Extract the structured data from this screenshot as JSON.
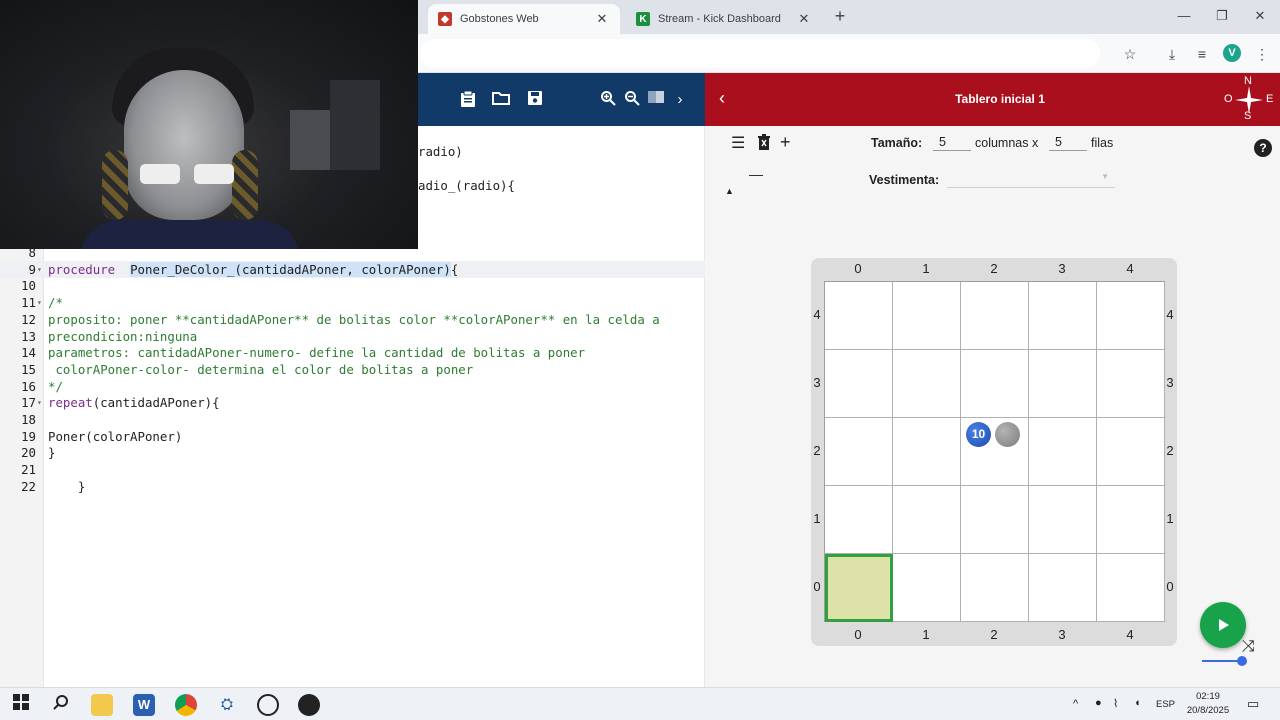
{
  "browser": {
    "tabs": [
      {
        "label": "Gobstones Web",
        "favicon": "gobstones-icon",
        "color": "#c0392b",
        "active": true
      },
      {
        "label": "Stream - Kick Dashboard",
        "favicon": "kick-icon",
        "color": "#1e8e3e",
        "active": false
      }
    ],
    "new_tab": "+",
    "window_controls": {
      "minimize": "—",
      "maximize": "❐",
      "close": "✕"
    },
    "avatar_letter": "V"
  },
  "editor": {
    "lines": [
      {
        "n": "8",
        "fold": "",
        "segments": []
      },
      {
        "n": "9",
        "fold": "▾",
        "current": true,
        "segments": [
          {
            "t": "procedure",
            "c": "kw"
          },
          {
            "t": "  ",
            "c": ""
          },
          {
            "t": "Poner_DeColor_(cantidadAPoner, colorAPoner)",
            "c": "sel"
          },
          {
            "t": "{",
            "c": ""
          }
        ]
      },
      {
        "n": "10",
        "fold": "",
        "segments": []
      },
      {
        "n": "11",
        "fold": "▾",
        "segments": [
          {
            "t": "/*",
            "c": "cm"
          }
        ]
      },
      {
        "n": "12",
        "fold": "",
        "segments": [
          {
            "t": "proposito: poner **cantidadAPoner** de bolitas color **colorAPoner** en la celda a",
            "c": "cm"
          }
        ]
      },
      {
        "n": "13",
        "fold": "",
        "segments": [
          {
            "t": "precondicion:ninguna",
            "c": "cm"
          }
        ]
      },
      {
        "n": "14",
        "fold": "",
        "segments": [
          {
            "t": "parametros: cantidadAPoner-numero- define la cantidad de bolitas a poner",
            "c": "cm"
          }
        ]
      },
      {
        "n": "15",
        "fold": "",
        "segments": [
          {
            "t": " colorAPoner-color- determina el color de bolitas a poner",
            "c": "cm"
          }
        ]
      },
      {
        "n": "16",
        "fold": "",
        "segments": [
          {
            "t": "*/",
            "c": "cm"
          }
        ]
      },
      {
        "n": "17",
        "fold": "▾",
        "segments": [
          {
            "t": "repeat",
            "c": "kw"
          },
          {
            "t": "(cantidadAPoner){",
            "c": ""
          }
        ]
      },
      {
        "n": "18",
        "fold": "",
        "segments": []
      },
      {
        "n": "19",
        "fold": "",
        "segments": [
          {
            "t": "Poner(colorAPoner)",
            "c": ""
          }
        ]
      },
      {
        "n": "20",
        "fold": "",
        "segments": [
          {
            "t": "}",
            "c": ""
          }
        ]
      },
      {
        "n": "21",
        "fold": "",
        "segments": []
      },
      {
        "n": "22",
        "fold": "",
        "segments": [
          {
            "t": "    }",
            "c": ""
          }
        ]
      }
    ],
    "hidden_fragment_1": "radio)",
    "hidden_fragment_2": "adio_(radio){"
  },
  "board": {
    "title": "Tablero inicial 1",
    "compass": {
      "n": "N",
      "s": "S",
      "e": "E",
      "o": "O"
    },
    "size_label": "Tamaño:",
    "columns_value": "5",
    "columns_label": "columnas x",
    "rows_value": "5",
    "rows_label": "filas",
    "attire_label": "Vestimenta:",
    "help": "?",
    "columns": [
      "0",
      "1",
      "2",
      "3",
      "4"
    ],
    "rows_top_to_bottom": [
      "4",
      "3",
      "2",
      "1",
      "0"
    ],
    "head_cell": {
      "x": 0,
      "y": 0
    },
    "stones": [
      {
        "x": 2,
        "y": 2,
        "color": "blue",
        "count": "10"
      },
      {
        "x": 2,
        "y": 2,
        "color": "gray",
        "count": ""
      }
    ],
    "colors": {
      "header": "#a90f1d",
      "head_border": "#30a040",
      "head_fill": "#dde3a8"
    }
  },
  "editor_header_color": "#113a68",
  "taskbar": {
    "lang": "ESP",
    "time": "02:19",
    "date": "20/8/2025"
  }
}
